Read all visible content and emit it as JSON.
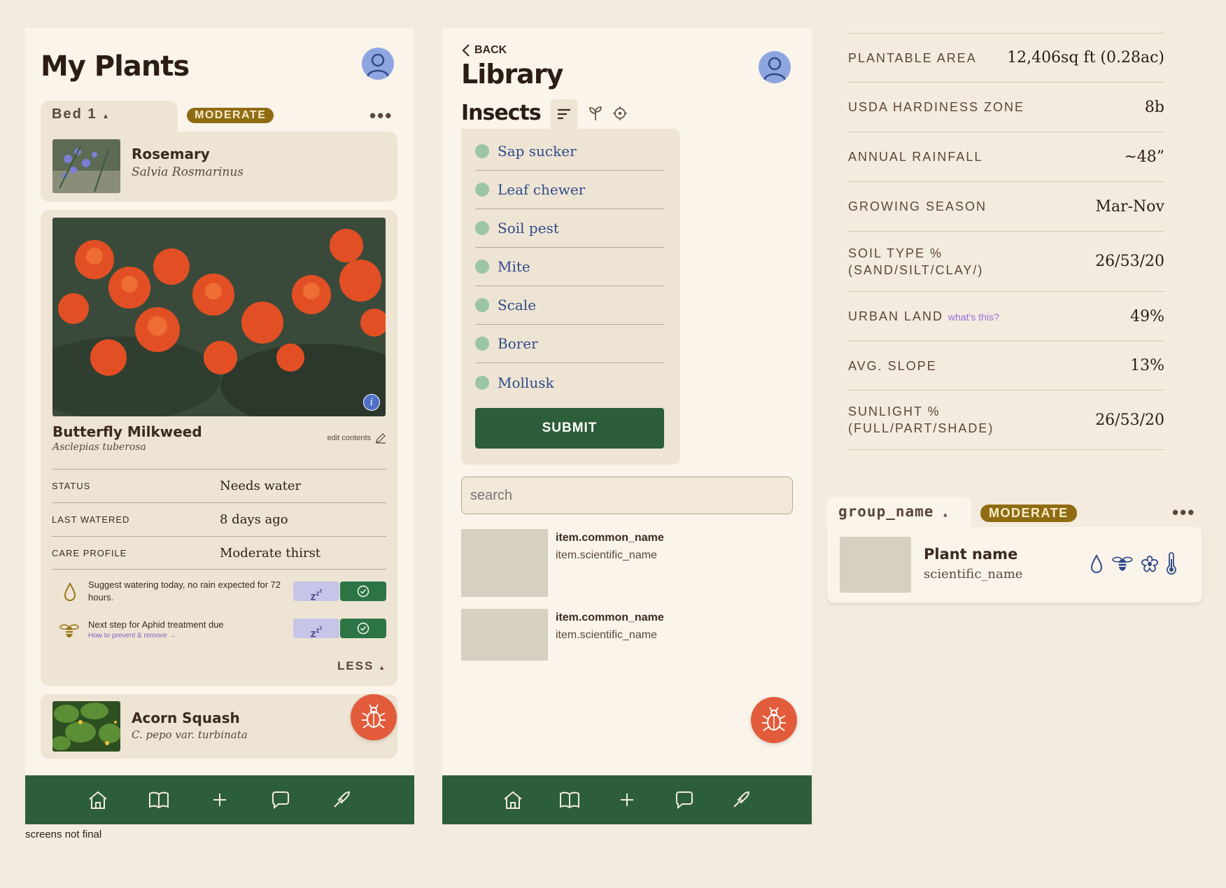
{
  "screen1": {
    "title": "My Plants",
    "bed_tab": "Bed 1",
    "badge": "MODERATE",
    "rosemary": {
      "name": "Rosemary",
      "scientific": "Salvia Rosmarinus"
    },
    "featured": {
      "name": "Butterfly Milkweed",
      "scientific": "Asclepias tuberosa",
      "edit": "edit contents",
      "rows": [
        {
          "label": "STATUS",
          "value": "Needs water"
        },
        {
          "label": "LAST WATERED",
          "value": "8 days ago"
        },
        {
          "label": "CARE PROFILE",
          "value": "Moderate thirst"
        }
      ],
      "task1": "Suggest watering today, no rain expected for 72 hours.",
      "task2": "Next step for Aphid treatment due",
      "task2_link": "How to prevent & remove →",
      "less": "LESS"
    },
    "acorn": {
      "name": "Acorn Squash",
      "scientific": "C. pepo var. turbinata"
    }
  },
  "screen2": {
    "back": "BACK",
    "title": "Library",
    "section": "Insects",
    "insects": [
      "Sap sucker",
      "Leaf chewer",
      "Soil pest",
      "Mite",
      "Scale",
      "Borer",
      "Mollusk"
    ],
    "submit": "SUBMIT",
    "search_placeholder": "search",
    "items": [
      {
        "common": "item.common_name",
        "scientific": "item.scientific_name"
      },
      {
        "common": "item.common_name",
        "scientific": "item.scientific_name"
      }
    ]
  },
  "screen3": {
    "properties": [
      {
        "label": "PLANTABLE AREA",
        "value": "12,406sq ft (0.28ac)"
      },
      {
        "label": "USDA HARDINESS ZONE",
        "value": "8b"
      },
      {
        "label": "ANNUAL RAINFALL",
        "value": "~48”"
      },
      {
        "label": "GROWING SEASON",
        "value": "Mar-Nov"
      },
      {
        "label": "SOIL TYPE %",
        "label2": "(SAND/SILT/CLAY/)",
        "value": "26/53/20"
      },
      {
        "label": "URBAN LAND",
        "link": "what's this?",
        "value": "49%"
      },
      {
        "label": "AVG. SLOPE",
        "value": "13%"
      },
      {
        "label": "SUNLIGHT %",
        "label2": "(FULL/PART/SHADE)",
        "value": "26/53/20"
      }
    ],
    "group_name": "group_name",
    "badge": "MODERATE",
    "plant_name": "Plant name",
    "scientific_name": "scientific_name"
  },
  "footnote": "screens not final",
  "colors": {
    "nav_green": "#2d5e3a",
    "badge_gold": "#8f6b12",
    "fab_orange": "#e25c3b",
    "avatar_blue": "#8ea6e0"
  },
  "icons": [
    "home-icon",
    "book-icon",
    "plus-icon",
    "chat-icon",
    "trowel-icon",
    "bug-icon",
    "water-drop-icon",
    "bee-icon",
    "flower-icon",
    "thermometer-icon",
    "filter-icon",
    "sprout-icon",
    "target-icon",
    "chevron-left-icon",
    "edit-icon",
    "info-icon",
    "check-icon",
    "user-icon"
  ]
}
